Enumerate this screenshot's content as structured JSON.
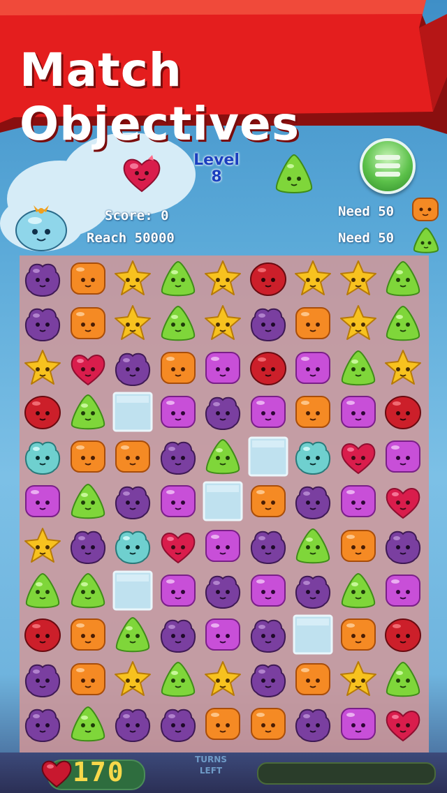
{
  "banner": {
    "title": "Match Objectives"
  },
  "header": {
    "level_label": "Level",
    "level_number": "8",
    "score_text": "Score: 0",
    "reach_text": "Reach 50000",
    "objectives": [
      {
        "text": "Need 50",
        "piece": "orange-square"
      },
      {
        "text": "Need 50",
        "piece": "green-triangle"
      }
    ]
  },
  "footer": {
    "moves_left": "170",
    "turns_label_line1": "TURNS",
    "turns_label_line2": "LEFT"
  },
  "board": {
    "rows": [
      [
        "purple-cloud",
        "orange-square",
        "yellow-star",
        "green-triangle",
        "yellow-star",
        "red-blob",
        "yellow-star",
        "yellow-star",
        "green-triangle"
      ],
      [
        "purple-cloud",
        "orange-square",
        "yellow-star",
        "green-triangle",
        "yellow-star",
        "purple-cloud",
        "orange-square",
        "yellow-star",
        "green-triangle"
      ],
      [
        "yellow-star",
        "red-heart",
        "purple-cloud",
        "orange-square",
        "magenta-square",
        "red-blob",
        "magenta-square",
        "green-triangle",
        "yellow-star"
      ],
      [
        "red-blob",
        "green-triangle",
        "ice",
        "magenta-square",
        "purple-cloud",
        "magenta-square",
        "orange-square",
        "magenta-square",
        "red-blob"
      ],
      [
        "teal-cloud",
        "orange-square",
        "orange-square",
        "purple-cloud",
        "green-triangle",
        "ice",
        "teal-cloud",
        "red-heart",
        "magenta-square"
      ],
      [
        "magenta-square",
        "green-triangle",
        "purple-cloud",
        "magenta-square",
        "ice",
        "orange-square",
        "purple-cloud",
        "magenta-square",
        "red-heart"
      ],
      [
        "yellow-star",
        "purple-cloud",
        "teal-cloud",
        "red-heart",
        "magenta-square",
        "purple-cloud",
        "green-triangle",
        "orange-square",
        "purple-cloud"
      ],
      [
        "green-triangle",
        "green-triangle",
        "ice",
        "magenta-square",
        "purple-cloud",
        "magenta-square",
        "purple-cloud",
        "green-triangle",
        "magenta-square"
      ],
      [
        "red-blob",
        "orange-square",
        "green-triangle",
        "purple-cloud",
        "magenta-square",
        "purple-cloud",
        "ice",
        "orange-square",
        "red-blob"
      ],
      [
        "purple-cloud",
        "orange-square",
        "yellow-star",
        "green-triangle",
        "yellow-star",
        "purple-cloud",
        "orange-square",
        "yellow-star",
        "green-triangle"
      ],
      [
        "purple-cloud",
        "green-triangle",
        "purple-cloud",
        "purple-cloud",
        "orange-square",
        "orange-square",
        "purple-cloud",
        "magenta-square",
        "red-heart"
      ]
    ]
  },
  "colors": {
    "banner_red": "#e41e1e",
    "level_blue": "#1a3fbf",
    "moves_yellow": "#f6d84a"
  }
}
